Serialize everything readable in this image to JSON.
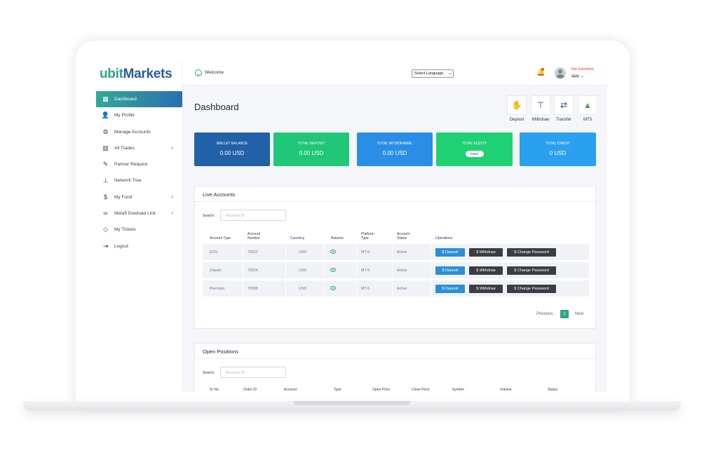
{
  "brand": {
    "logo_part1": "ubit",
    "logo_part2": "Markets",
    "accent": "#2fa285",
    "primary": "#2a5b96"
  },
  "sidebar": {
    "items": [
      {
        "label": "Dashboard",
        "icon": "grid-icon",
        "active": true
      },
      {
        "label": "My Profile",
        "icon": "user-icon"
      },
      {
        "label": "Manage Accounts",
        "icon": "user-gear-icon"
      },
      {
        "label": "All Trades",
        "icon": "bar-chart-icon",
        "chevron": true
      },
      {
        "label": "Partner Request",
        "icon": "edit-icon"
      },
      {
        "label": "Network Tree",
        "icon": "sitemap-icon"
      },
      {
        "label": "My Fund",
        "icon": "dollar-icon",
        "chevron": true
      },
      {
        "label": "Meta5 Dowload Link",
        "icon": "link-icon",
        "chevron": true
      },
      {
        "label": "My Tickets",
        "icon": "ticket-icon"
      },
      {
        "label": "Logout",
        "icon": "logout-icon"
      }
    ]
  },
  "header": {
    "welcome": "Welcome",
    "language_select": "Select Language",
    "status": "Not Submitted",
    "username": "ajay"
  },
  "page": {
    "title": "Dashboard",
    "quick_actions": [
      {
        "label": "Deposit",
        "icon": "deposit-icon"
      },
      {
        "label": "Withdraw",
        "icon": "withdraw-icon"
      },
      {
        "label": "Transfer",
        "icon": "transfer-icon"
      },
      {
        "label": "MT5",
        "icon": "mt5-icon"
      }
    ]
  },
  "cards": [
    {
      "title": "WALLET BALANCE",
      "value": "0.00 USD",
      "color": "#2161a8"
    },
    {
      "title": "TOTAL DEPOSIT",
      "value": "0.00 USD",
      "color": "#1fc776"
    },
    {
      "title": "TOTAL WITHDRAWAL",
      "value": "0.00 USD",
      "color": "#2a8ee6"
    },
    {
      "title": "TOTAL EQUITY",
      "button": "Fetch",
      "color": "#1fd174"
    },
    {
      "title": "TOTAL CREDIT",
      "value": "0 USD",
      "color": "#2aa0ef"
    }
  ],
  "live_accounts": {
    "title": "Live Accounts",
    "search_label": "Search:",
    "search_placeholder": "Account ID",
    "columns": [
      [
        "Account Type"
      ],
      [
        "Account",
        "Number"
      ],
      [
        "Currency"
      ],
      [
        "Balance"
      ],
      [
        "Platform",
        "Type"
      ],
      [
        "Account",
        "Status"
      ],
      [
        "Operations"
      ]
    ],
    "rows": [
      {
        "type": "ECN",
        "number": "70222",
        "currency": "USD",
        "platform": "MT-5",
        "status": "Active"
      },
      {
        "type": "Classic",
        "number": "70224",
        "currency": "USD",
        "platform": "MT-5",
        "status": "Active"
      },
      {
        "type": "Premium",
        "number": "70289",
        "currency": "USD",
        "platform": "MT-5",
        "status": "Active"
      }
    ],
    "buttons": {
      "deposit": "$ Deposit",
      "withdraw": "$ Withdraw",
      "change_password": "$ Change Password"
    },
    "pager": {
      "previous": "Previous",
      "current": "1",
      "next": "Next"
    }
  },
  "open_positions": {
    "title": "Open Positions",
    "search_label": "Search:",
    "search_placeholder": "Account ID",
    "columns": [
      "Sr No.",
      "Order ID",
      "Account",
      "Type",
      "Open Price",
      "Close Price",
      "Symbol",
      "Volume",
      "Status"
    ]
  }
}
